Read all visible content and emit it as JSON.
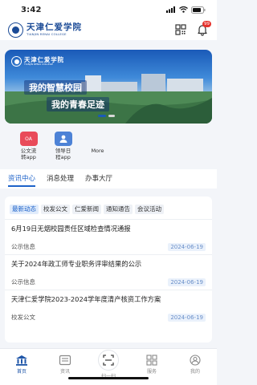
{
  "status_bar": {
    "time": "3:42",
    "icons": [
      "signal-icon",
      "wifi-icon",
      "battery-icon"
    ]
  },
  "header": {
    "logo_cn": "天津仁爱学院",
    "logo_en": "TIANJIN RENAI COLLEGE",
    "icons": [
      "qr-code-icon",
      "bell-icon"
    ],
    "notification_badge": "99"
  },
  "banner": {
    "logo_cn": "天津仁爱学院",
    "logo_en": "TIANJIN RENAI COLLEGE",
    "line1": "我的智慧校园",
    "line2": "我的青春足迹",
    "slide_count": 2,
    "active_slide": 1
  },
  "shortcuts": [
    {
      "label_line1": "公文流",
      "label_line2": "转app",
      "icon": "document-flow-icon",
      "icon_text": "OA",
      "color": "#e94b5a"
    },
    {
      "label_line1": "领导日",
      "label_line2": "程app",
      "icon": "person-schedule-icon",
      "icon_text": "",
      "color": "#4d82d6"
    },
    {
      "label_line1": "More",
      "label_line2": "",
      "icon": "grid-more-icon",
      "icon_text": "",
      "color": "#b9c2d3"
    }
  ],
  "tabs": [
    {
      "label": "资讯中心",
      "active": true
    },
    {
      "label": "消息处理",
      "active": false
    },
    {
      "label": "办事大厅",
      "active": false
    }
  ],
  "chips": [
    {
      "label": "最新动态",
      "active": true
    },
    {
      "label": "校发公文",
      "active": false
    },
    {
      "label": "仁爱新闻",
      "active": false
    },
    {
      "label": "通知通告",
      "active": false
    },
    {
      "label": "会议活动",
      "active": false
    }
  ],
  "news": [
    {
      "title": "6月19日无烟校园责任区域检查情况通报",
      "category": "公示信息",
      "date": "2024-06-19"
    },
    {
      "title": "关于2024年政工师专业职务评审结果的公示",
      "category": "公示信息",
      "date": "2024-06-19"
    },
    {
      "title": "天津仁爱学院2023-2024学年度清产核资工作方案",
      "category": "校发公文",
      "date": "2024-06-19"
    }
  ],
  "tabbar": [
    {
      "label": "首页",
      "icon": "home-icon",
      "active": true
    },
    {
      "label": "资讯",
      "icon": "news-icon",
      "active": false
    },
    {
      "label": "扫一扫",
      "icon": "scan-icon",
      "active": false
    },
    {
      "label": "服务",
      "icon": "service-grid-icon",
      "active": false
    },
    {
      "label": "我的",
      "icon": "profile-icon",
      "active": false
    }
  ],
  "colors": {
    "accent": "#1d62c9",
    "badge": "#e5312c",
    "brand": "#1a4a96"
  }
}
